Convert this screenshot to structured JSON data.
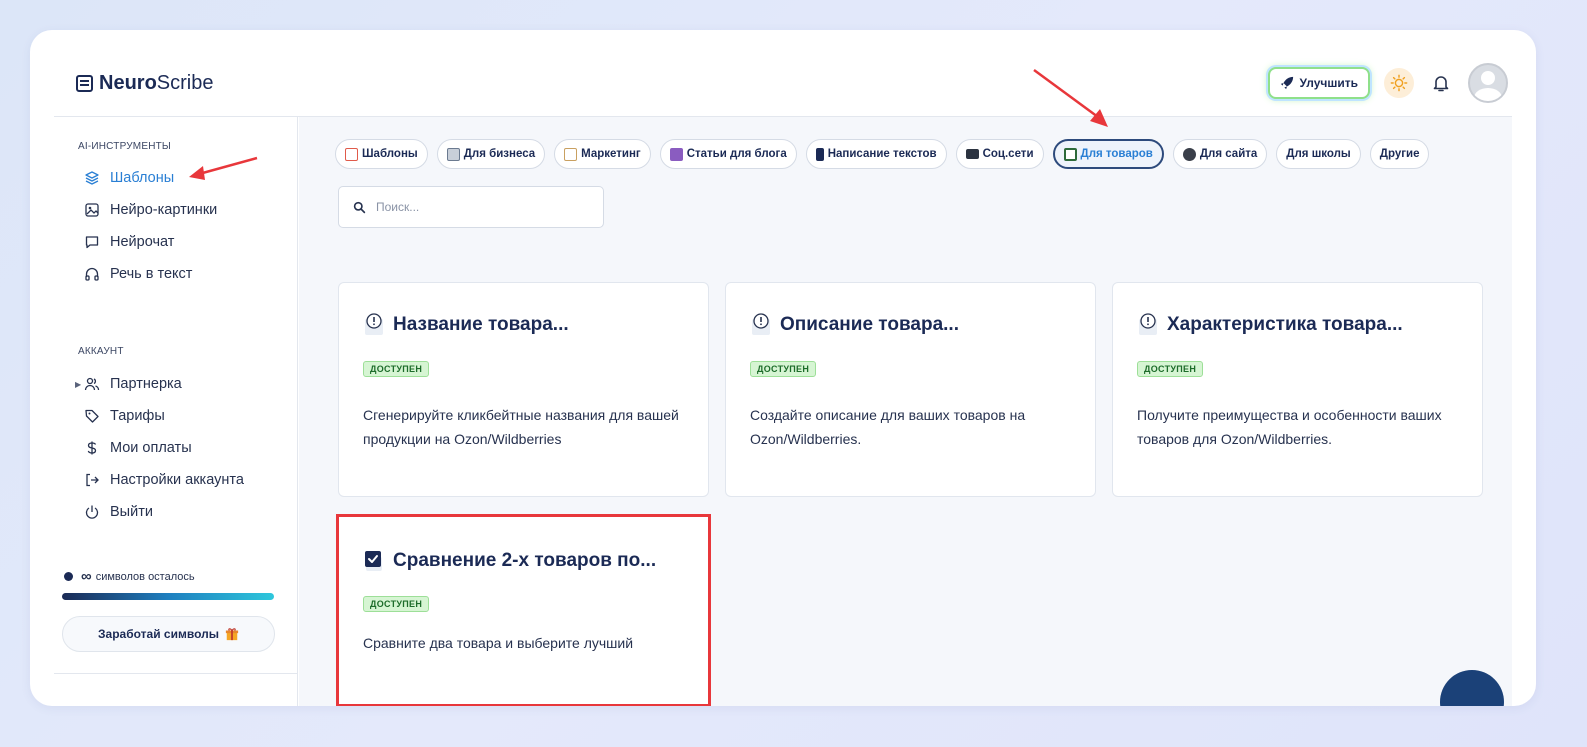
{
  "app": {
    "name_bold": "Neuro",
    "name_rest": "Scribe"
  },
  "header": {
    "upgrade_label": "Улучшить"
  },
  "sidebar": {
    "tools_title": "AI-ИНСТРУМЕНТЫ",
    "tools": [
      {
        "label": "Шаблоны",
        "icon": "layers-icon",
        "active": true
      },
      {
        "label": "Нейро-картинки",
        "icon": "image-icon"
      },
      {
        "label": "Нейрочат",
        "icon": "chat-icon"
      },
      {
        "label": "Речь в текст",
        "icon": "headphones-icon"
      }
    ],
    "account_title": "АККАУНТ",
    "account": [
      {
        "label": "Партнерка",
        "icon": "users-icon"
      },
      {
        "label": "Тарифы",
        "icon": "tag-icon"
      },
      {
        "label": "Мои оплаты",
        "icon": "dollar-icon"
      },
      {
        "label": "Настройки аккаунта",
        "icon": "login-icon"
      },
      {
        "label": "Выйти",
        "icon": "power-icon"
      }
    ],
    "symbols_count": "∞",
    "symbols_text": "символов осталось",
    "symbols_progress": 1.0,
    "earn_label": "Заработай символы"
  },
  "tabs": [
    {
      "label": "Шаблоны",
      "icon_color": "#e05a4a"
    },
    {
      "label": "Для бизнеса",
      "icon_color": "#6b7a90"
    },
    {
      "label": "Маркетинг",
      "icon_color": "#c9a060"
    },
    {
      "label": "Статьи для блога",
      "icon_color": "#8a5cc0"
    },
    {
      "label": "Написание текстов",
      "icon_color": "#1b2a55"
    },
    {
      "label": "Соц.сети",
      "icon_color": "#2b3340"
    },
    {
      "label": "Для товаров",
      "icon_color": "#2d6a3a",
      "active": true
    },
    {
      "label": "Для сайта",
      "icon_color": "#3a3f4a"
    },
    {
      "label": "Для школы",
      "icon_color": ""
    },
    {
      "label": "Другие",
      "icon_color": ""
    }
  ],
  "search": {
    "placeholder": "Поиск..."
  },
  "cards": [
    {
      "title": "Название товара...",
      "badge": "ДОСТУПЕН",
      "desc": "Сгенерируйте кликбейтные названия для вашей продукции на Ozon/Wildberries",
      "icon": "warning-note-icon"
    },
    {
      "title": "Описание товара...",
      "badge": "ДОСТУПЕН",
      "desc": "Создайте описание для ваших товаров на Ozon/Wildberries.",
      "icon": "warning-note-icon"
    },
    {
      "title": "Характеристика товара...",
      "badge": "ДОСТУПЕН",
      "desc": "Получите преимущества и особенности ваших товаров для Ozon/Wildberries.",
      "icon": "warning-note-icon"
    },
    {
      "title": "Сравнение 2-х товаров по...",
      "badge": "ДОСТУПЕН",
      "desc": "Сравните два товара и выберите лучший",
      "icon": "checkbox-icon"
    }
  ],
  "colors": {
    "accent": "#2a7fd4",
    "navy": "#1b2a55",
    "highlight": "#e8373b"
  }
}
